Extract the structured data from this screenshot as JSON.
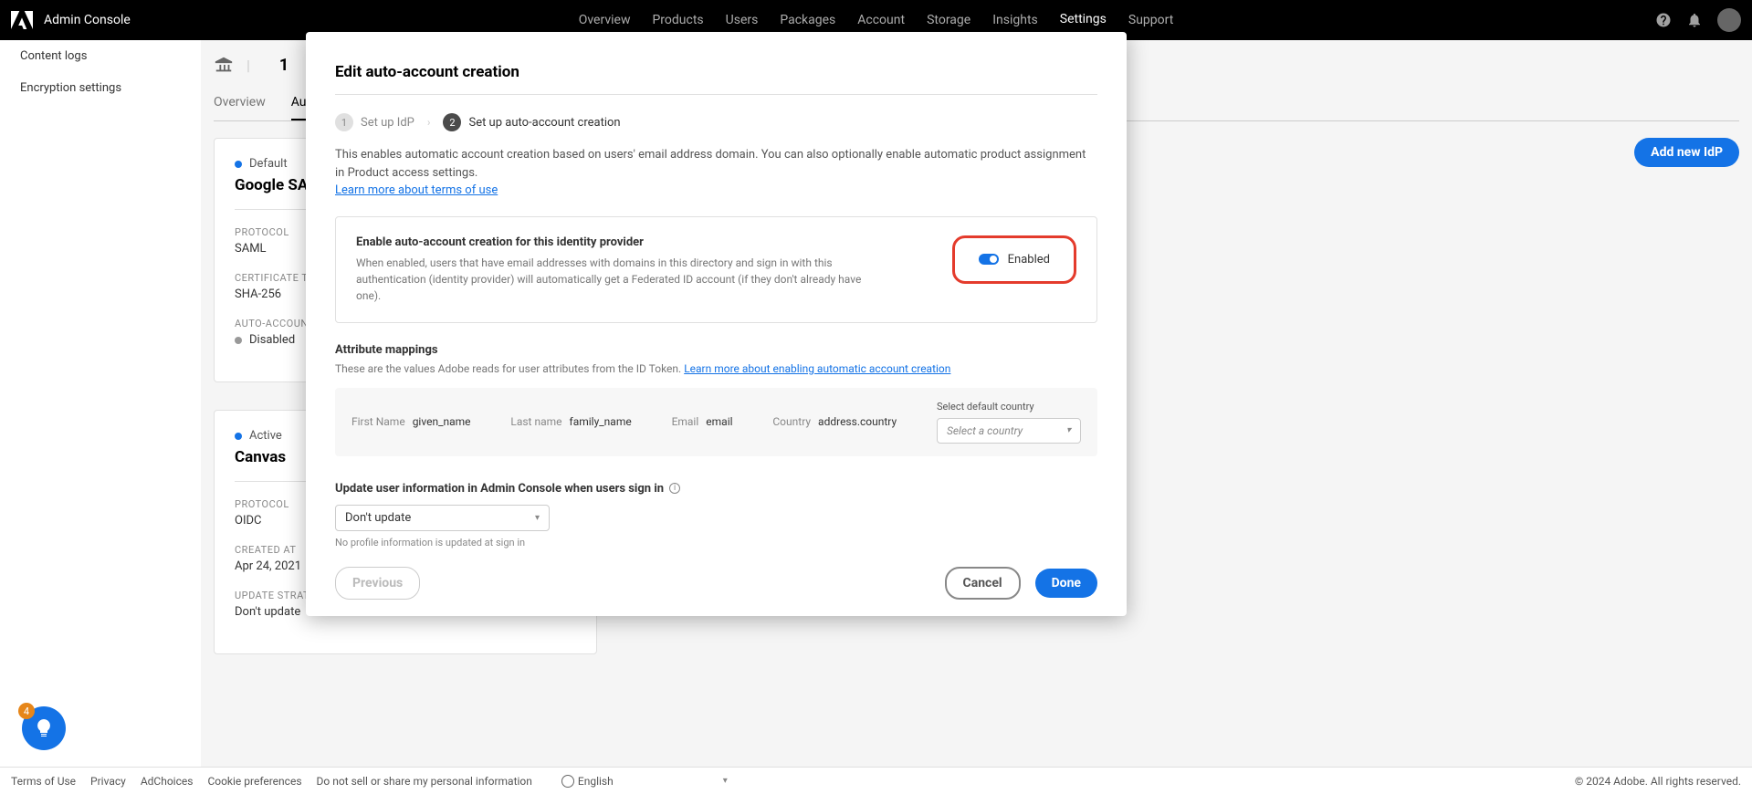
{
  "header": {
    "title": "Admin Console",
    "nav": [
      "Overview",
      "Products",
      "Users",
      "Packages",
      "Account",
      "Storage",
      "Insights",
      "Settings",
      "Support"
    ],
    "nav_active": "Settings"
  },
  "sidebar": {
    "items": [
      "Content logs",
      "Encryption settings"
    ]
  },
  "page": {
    "count": "1",
    "tabs": [
      "Overview",
      "Authentication"
    ],
    "add_button": "Add new IdP"
  },
  "cards": [
    {
      "status": "Default",
      "title": "Google SAML",
      "fields": [
        {
          "label": "PROTOCOL",
          "value": "SAML"
        },
        {
          "label": "CERTIFICATE TYPE",
          "value": "SHA-256"
        },
        {
          "label": "AUTO-ACCOUNT CREATION",
          "value": "Disabled",
          "dot": true
        }
      ]
    },
    {
      "status": "Active",
      "title": "Canvas",
      "fields": [
        {
          "label": "PROTOCOL",
          "value": "OIDC"
        },
        {
          "label": "CREATED AT",
          "value": "Apr 24, 2021"
        },
        {
          "label": "UPDATE STRATEGY",
          "value": "Don't update"
        }
      ]
    }
  ],
  "modal": {
    "title": "Edit auto-account creation",
    "step1": "Set up IdP",
    "step2": "Set up auto-account creation",
    "description": "This enables automatic account creation based on users' email address domain. You can also optionally enable automatic product assignment in Product access settings.",
    "learn_link": "Learn more about terms of use",
    "panel_title": "Enable auto-account creation for this identity provider",
    "panel_desc": "When enabled, users that have email addresses with domains in this directory and sign in with this authentication (identity provider) will automatically get a Federated ID account (if they don't already have one).",
    "toggle_label": "Enabled",
    "attr_title": "Attribute mappings",
    "attr_desc": "These are the values Adobe reads for user attributes from the ID Token.",
    "attr_link": "Learn more about enabling automatic account creation",
    "attrs": {
      "first_name_label": "First Name",
      "first_name_value": "given_name",
      "last_name_label": "Last name",
      "last_name_value": "family_name",
      "email_label": "Email",
      "email_value": "email",
      "country_label": "Country",
      "country_value": "address.country",
      "country_select_label": "Select default country",
      "country_select_value": "Select a country"
    },
    "update_title": "Update user information in Admin Console when users sign in",
    "update_value": "Don't update",
    "update_hint": "No profile information is updated at sign in",
    "btn_prev": "Previous",
    "btn_cancel": "Cancel",
    "btn_done": "Done"
  },
  "footer": {
    "links": [
      "Terms of Use",
      "Privacy",
      "AdChoices",
      "Cookie preferences",
      "Do not sell or share my personal information"
    ],
    "language": "English",
    "copyright": "© 2024 Adobe. All rights reserved."
  },
  "help": {
    "count": "4"
  }
}
